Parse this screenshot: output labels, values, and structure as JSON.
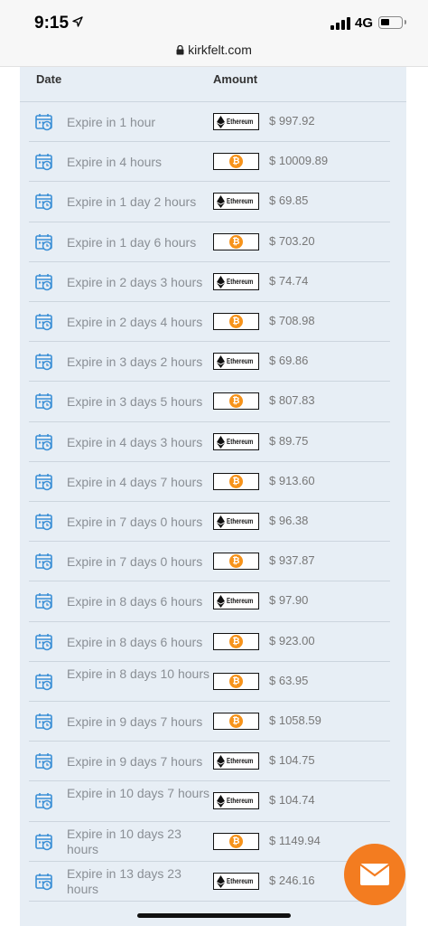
{
  "status_bar": {
    "time": "9:15",
    "network": "4G"
  },
  "browser": {
    "url": "kirkfelt.com"
  },
  "table": {
    "headers": {
      "date": "Date",
      "amount": "Amount"
    },
    "rows": [
      {
        "expire": "Expire in 1 hour",
        "coin": "ethereum",
        "amount": "$ 997.92"
      },
      {
        "expire": "Expire in 4 hours",
        "coin": "bitcoin",
        "amount": "$ 10009.89"
      },
      {
        "expire": "Expire in 1 day 2 hours",
        "coin": "ethereum",
        "amount": "$ 69.85"
      },
      {
        "expire": "Expire in 1 day 6 hours",
        "coin": "bitcoin",
        "amount": "$ 703.20"
      },
      {
        "expire": "Expire in 2 days 3 hours",
        "coin": "ethereum",
        "amount": "$ 74.74"
      },
      {
        "expire": "Expire in 2 days 4 hours",
        "coin": "bitcoin",
        "amount": "$ 708.98"
      },
      {
        "expire": "Expire in 3 days 2 hours",
        "coin": "ethereum",
        "amount": "$ 69.86"
      },
      {
        "expire": "Expire in 3 days 5 hours",
        "coin": "bitcoin",
        "amount": "$ 807.83"
      },
      {
        "expire": "Expire in 4 days 3 hours",
        "coin": "ethereum",
        "amount": "$ 89.75"
      },
      {
        "expire": "Expire in 4 days 7 hours",
        "coin": "bitcoin",
        "amount": "$ 913.60"
      },
      {
        "expire": "Expire in 7 days 0 hours",
        "coin": "ethereum",
        "amount": "$ 96.38"
      },
      {
        "expire": "Expire in 7 days 0 hours",
        "coin": "bitcoin",
        "amount": "$ 937.87"
      },
      {
        "expire": "Expire in 8 days 6 hours",
        "coin": "ethereum",
        "amount": "$ 97.90"
      },
      {
        "expire": "Expire in 8 days 6 hours",
        "coin": "bitcoin",
        "amount": "$ 923.00"
      },
      {
        "expire": "Expire in 8 days 10 hours",
        "coin": "bitcoin",
        "amount": "$ 63.95"
      },
      {
        "expire": "Expire in 9 days 7 hours",
        "coin": "bitcoin",
        "amount": "$ 1058.59"
      },
      {
        "expire": "Expire in 9 days 7 hours",
        "coin": "ethereum",
        "amount": "$ 104.75"
      },
      {
        "expire": "Expire in 10 days 7 hours",
        "coin": "ethereum",
        "amount": "$ 104.74"
      },
      {
        "expire": "Expire in 10 days 23 hours",
        "coin": "bitcoin",
        "amount": "$ 1149.94"
      },
      {
        "expire": "Expire in 13 days 23 hours",
        "coin": "ethereum",
        "amount": "$ 246.16"
      }
    ]
  },
  "coin_labels": {
    "ethereum": "Ethereum",
    "bitcoin": "₿"
  },
  "colors": {
    "panel": "#e7eef5",
    "accent_orange": "#f37c20",
    "bitcoin": "#f7931a",
    "calendar_icon": "#3b8fd6"
  },
  "icons": {
    "calendar": "calendar-clock-icon",
    "mail": "mail-icon",
    "lock": "lock-icon"
  }
}
